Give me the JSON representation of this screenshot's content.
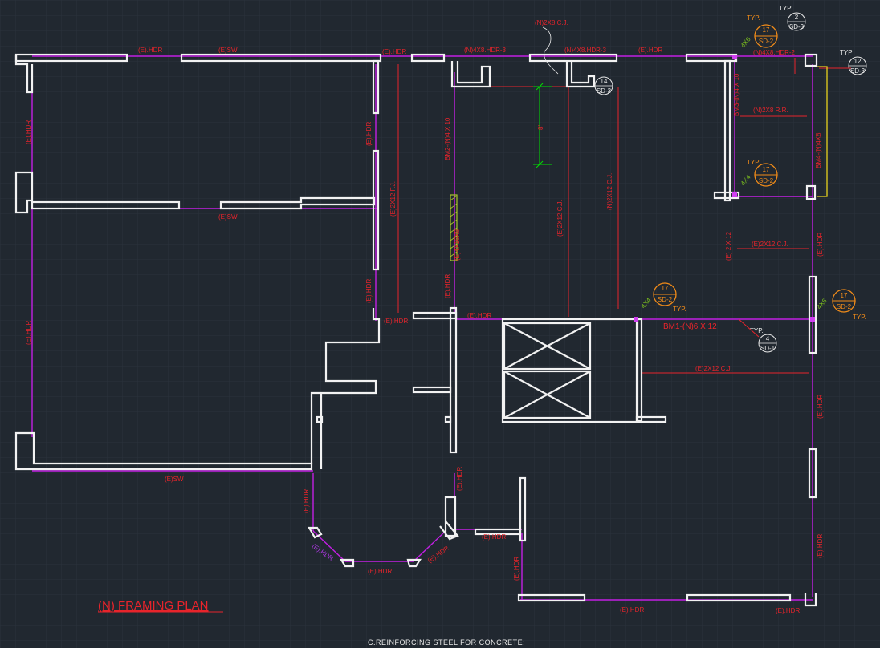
{
  "colors": {
    "background": "#212830",
    "grid": "#2a323c",
    "wall": "#f2f2f2",
    "beam": "#c21fe3",
    "label": "#e8242b",
    "callout": "#f28c19",
    "post": "#7fc41d",
    "dimension": "#00e000"
  },
  "plan": {
    "title": "(N) FRAMING PLAN",
    "footer_note": "C.REINFORCING STEEL FOR CONCRETE:"
  },
  "labels": {
    "e_hdr": "(E).HDR",
    "e_sw": "(E)SW",
    "n_4x8_hdr3": "(N)4X8.HDR-3",
    "n_4x8_hdr3b": "(N)4X8.HDR-3",
    "n_4x8_hdr2": "(N)4X8.HDR-2",
    "n_2x8_cj": "(N)2X8 C.J.",
    "bm2": "BM2-(N)4 X 10",
    "bm3": "BM3-(N)4 X 10",
    "bm4": "BM4-(N)4X8",
    "n_2x8_rr": "(N)2X8 R.R.",
    "e_2x12_fj": "(E)2X12 F.J.",
    "e_2x12_cj": "(E)2X12 C.J.",
    "n_2x12_cj": "(N)2X12 C.J.",
    "e_2x12_cj_h1": "(E)2X12 C.J.",
    "e_2x12_cj_h2": "(E)2X12 C.J.",
    "e_2x12_v": "(E) 2 X 12",
    "post": "(E)4X16X8",
    "bm1": "BM1-(N)6 X 12",
    "dim": "8'",
    "typ": "TYP.",
    "typ_plain": "TYP",
    "post4x6": "4X6",
    "post4x4": "4X4"
  },
  "callouts": [
    {
      "num": "17",
      "sheet": "SD-2"
    },
    {
      "num": "2",
      "sheet": "SD-3"
    },
    {
      "num": "12",
      "sheet": "SD-3"
    },
    {
      "num": "14",
      "sheet": "SD-3"
    },
    {
      "num": "17",
      "sheet": "SD-2"
    },
    {
      "num": "17",
      "sheet": "SD-2"
    },
    {
      "num": "17",
      "sheet": "SD-2"
    },
    {
      "num": "4",
      "sheet": "SD-1"
    }
  ]
}
